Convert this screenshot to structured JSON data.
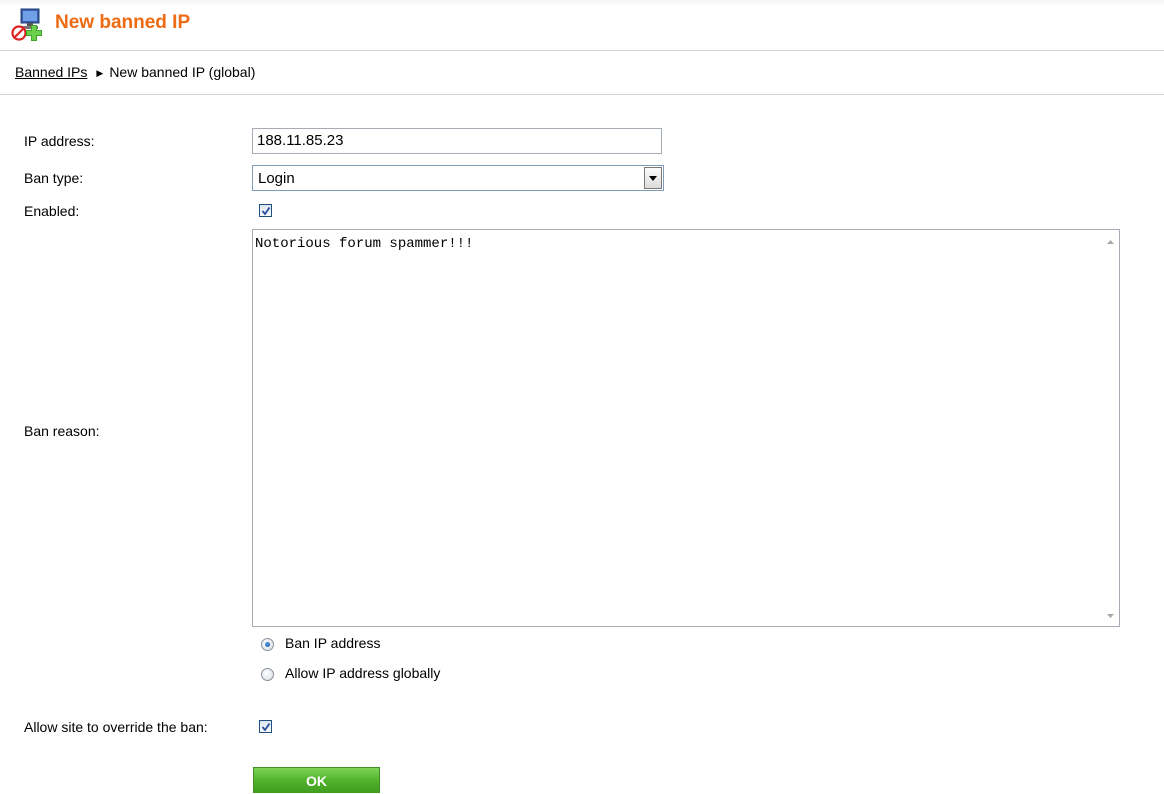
{
  "header": {
    "title": "New banned IP",
    "icon": "banned-ip-add-icon"
  },
  "breadcrumb": {
    "link_label": "Banned IPs",
    "current": "New banned IP (global)"
  },
  "form": {
    "ip_address": {
      "label": "IP address:",
      "value": "188.11.85.23"
    },
    "ban_type": {
      "label": "Ban type:",
      "value": "Login"
    },
    "enabled": {
      "label": "Enabled:",
      "checked": true
    },
    "ban_reason": {
      "label": "Ban reason:",
      "value": "Notorious forum spammer!!!"
    },
    "ban_mode": {
      "options": [
        {
          "label": "Ban IP address",
          "selected": true
        },
        {
          "label": "Allow IP address globally",
          "selected": false
        }
      ]
    },
    "allow_override": {
      "label": "Allow site to override the ban:",
      "checked": true
    },
    "ok_label": "OK"
  },
  "colors": {
    "title": "#ee6a13",
    "ok_button": "#54b52f",
    "divider": "#d4d4d4"
  }
}
